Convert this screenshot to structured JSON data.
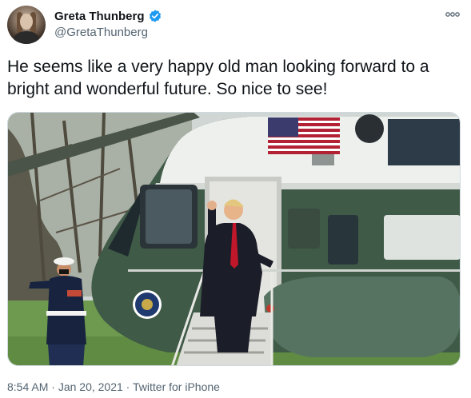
{
  "tweet": {
    "display_name": "Greta Thunberg",
    "handle": "@GretaThunberg",
    "text": "He seems like a very happy old man looking forward to a bright and wonderful future. So nice to see!",
    "time": "8:54 AM",
    "separator": " · ",
    "date": "Jan 20, 2021",
    "source": "Twitter for iPhone"
  },
  "icons": {
    "verified": "verified-badge-icon",
    "more": "more-options-icon"
  },
  "colors": {
    "verified_blue": "#1d9bf0",
    "secondary_text": "#536471",
    "primary_text": "#0f1419",
    "helicopter_green": "#3f5a47"
  },
  "media": {
    "description_visible": false
  }
}
